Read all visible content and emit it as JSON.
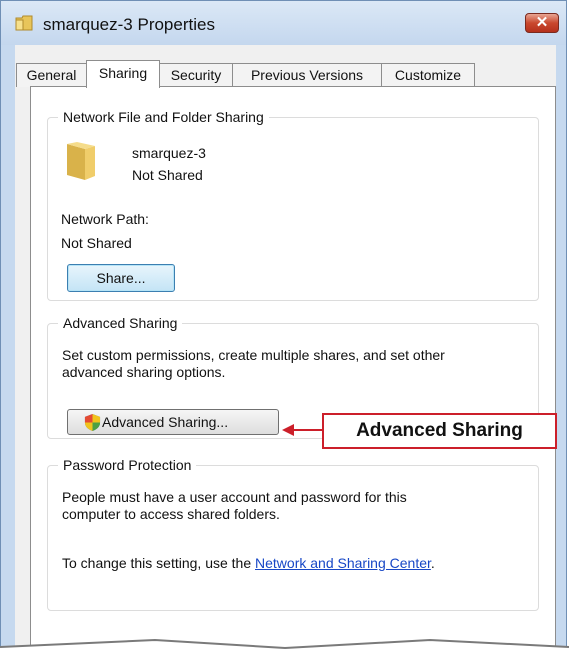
{
  "window": {
    "title": "smarquez-3 Properties",
    "close_glyph": "✕"
  },
  "tabs": [
    {
      "label": "General"
    },
    {
      "label": "Sharing"
    },
    {
      "label": "Security"
    },
    {
      "label": "Previous Versions"
    },
    {
      "label": "Customize"
    }
  ],
  "network_sharing": {
    "group_title": "Network File and Folder Sharing",
    "folder_name": "smarquez-3",
    "folder_status": "Not Shared",
    "path_label": "Network Path:",
    "path_value": "Not Shared",
    "share_button": "Share..."
  },
  "advanced_sharing": {
    "group_title": "Advanced Sharing",
    "description_line1": "Set custom permissions, create multiple shares, and set other",
    "description_line2": "advanced sharing options.",
    "button_label": "Advanced Sharing..."
  },
  "password_protection": {
    "group_title": "Password Protection",
    "line1": "People must have a user account and password for this",
    "line2": "computer to access shared folders.",
    "change_prefix": "To change this setting, use the ",
    "link_text": "Network and Sharing Center",
    "change_suffix": "."
  },
  "callout": {
    "label": "Advanced Sharing",
    "color": "#cc1f2a"
  },
  "icons": {
    "title": "folder-icon",
    "folder": "folder-icon",
    "shield": "uac-shield-icon"
  }
}
